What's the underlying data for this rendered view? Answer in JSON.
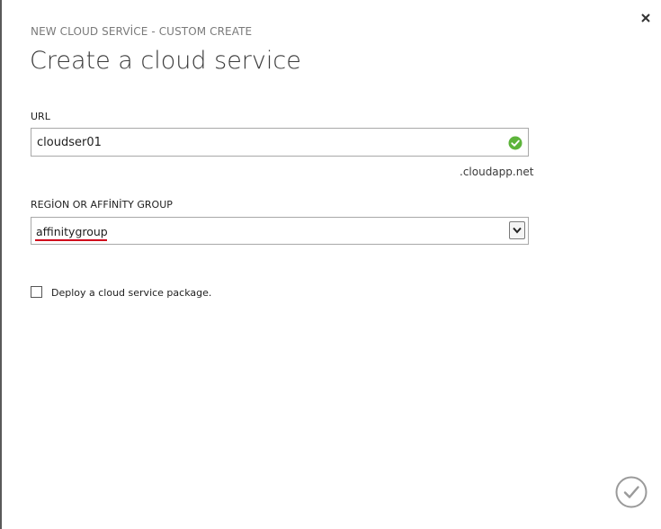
{
  "dialog": {
    "subtitle": "NEW CLOUD SERVİCE - CUSTOM CREATE",
    "title": "Create a cloud service",
    "close_icon": "close-icon"
  },
  "url_field": {
    "label": "URL",
    "value": "cloudser01",
    "status_icon": "valid-check-icon",
    "status_color": "#5db43b",
    "suffix": ".cloudapp.net"
  },
  "region_field": {
    "label": "REGİON OR AFFİNİTY GROUP",
    "selected": "affinitygroup",
    "dropdown_icon": "chevron-down-icon",
    "spellcheck_color": "#d0021b"
  },
  "deploy_option": {
    "label": "Deploy a cloud service package.",
    "checked": false
  },
  "footer": {
    "complete_icon": "checkmark-circle-icon"
  }
}
